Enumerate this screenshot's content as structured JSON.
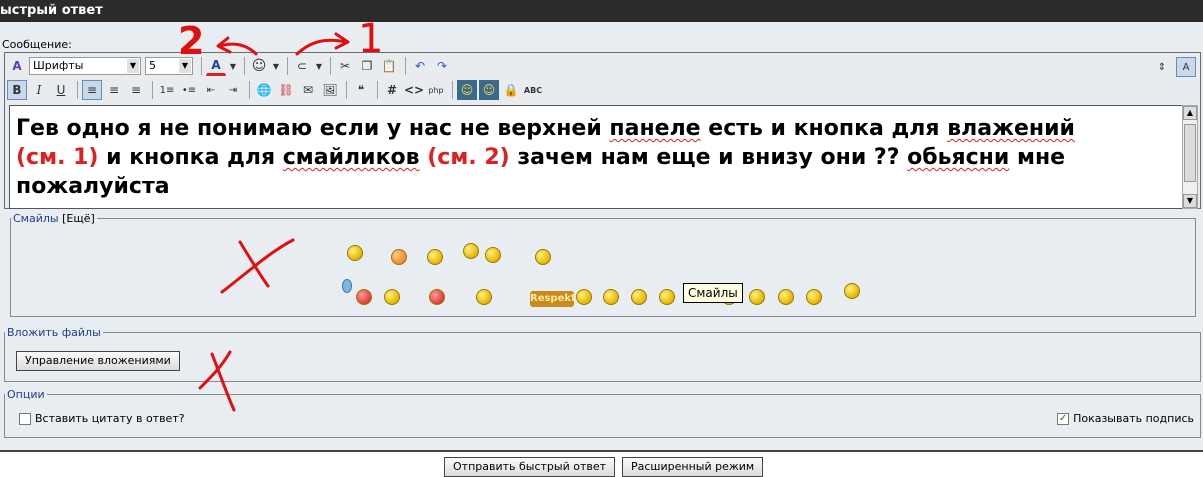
{
  "window": {
    "title": "ыстрый ответ"
  },
  "editor": {
    "label": "Сообщение:",
    "font_combo": "Шрифты",
    "size_combo": "5",
    "toolbar_row2_tag_label": "ABC",
    "text_parts": [
      "Гев одно я не понимаю если у нас не верхней ",
      "панеле",
      " есть и кнопка для ",
      "влажений",
      "(см. 1)",
      " и кнопка для ",
      "смайликов",
      "(см. 2)",
      " зачем нам еще и внизу они ?? ",
      "обьясни",
      " мне пожалуйста"
    ]
  },
  "smilies": {
    "legend": "Смайлы",
    "more_link": "[Ещё]",
    "tooltip": "Смайлы",
    "respekt_label": "Respekt"
  },
  "attachments": {
    "legend": "Вложить файлы",
    "manage_button": "Управление вложениями"
  },
  "options": {
    "legend": "Опции",
    "quote_label": "Вставить цитату в ответ?",
    "quote_checked": false,
    "signature_label": "Показывать подпись",
    "signature_checked": true
  },
  "actions": {
    "submit_label": "Отправить быстрый ответ",
    "advanced_label": "Расширенный режим"
  },
  "annotations": {
    "label_1": "1",
    "label_2": "2"
  },
  "colors": {
    "annotation": "#e01010",
    "legend": "#1d3e8a",
    "panel": "#e8edf2"
  }
}
